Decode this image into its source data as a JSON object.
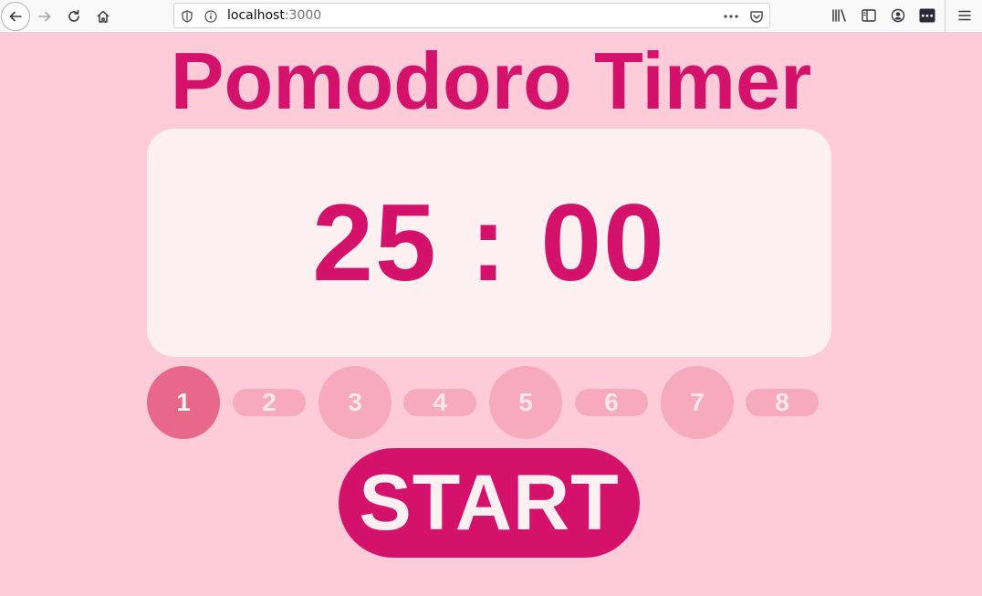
{
  "browser": {
    "url_host": "localhost",
    "url_port": ":3000"
  },
  "app": {
    "title": "Pomodoro Timer",
    "timer": "25 : 00",
    "sessions": [
      {
        "label": "1",
        "kind": "long",
        "active": true
      },
      {
        "label": "2",
        "kind": "short",
        "active": false
      },
      {
        "label": "3",
        "kind": "long",
        "active": false
      },
      {
        "label": "4",
        "kind": "short",
        "active": false
      },
      {
        "label": "5",
        "kind": "long",
        "active": false
      },
      {
        "label": "6",
        "kind": "short",
        "active": false
      },
      {
        "label": "7",
        "kind": "long",
        "active": false
      },
      {
        "label": "8",
        "kind": "short",
        "active": false
      }
    ],
    "start_label": "START"
  },
  "colors": {
    "background": "#fdccd8",
    "accent": "#d4126b",
    "card": "#fcf0f1",
    "session_active": "#e8688a",
    "session_inactive": "#f7aabb"
  }
}
